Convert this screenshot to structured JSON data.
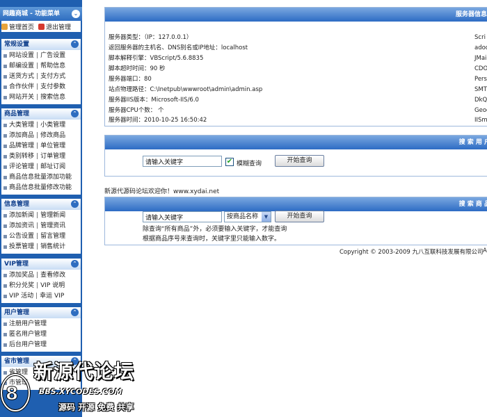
{
  "sidebar": {
    "title": "网趣商城 - 功能菜单",
    "home_link": "管理首页",
    "logout_link": "退出管理",
    "sections": [
      {
        "title": "常规设置",
        "rows": [
          [
            "网站设置",
            "广告设置"
          ],
          [
            "邮编设置",
            "帮助信息"
          ],
          [
            "送货方式",
            "支付方式"
          ],
          [
            "合作伙伴",
            "支付参数"
          ],
          [
            "网站开关",
            "搜索信息"
          ]
        ]
      },
      {
        "title": "商品管理",
        "rows": [
          [
            "大类管理",
            "小类管理"
          ],
          [
            "添加商品",
            "修改商品"
          ],
          [
            "品牌管理",
            "单位管理"
          ],
          [
            "类别转移",
            "订单管理"
          ],
          [
            "评论管理",
            "邮址订阅"
          ],
          [
            "商品信息批量添加功能"
          ],
          [
            "商品信息批量修改功能"
          ]
        ]
      },
      {
        "title": "信息管理",
        "rows": [
          [
            "添加新闻",
            "管理新闻"
          ],
          [
            "添加资讯",
            "管理资讯"
          ],
          [
            "公告设置",
            "留言管理"
          ],
          [
            "投票管理",
            "销售统计"
          ]
        ]
      },
      {
        "title": "VIP管理",
        "rows": [
          [
            "添加奖品",
            "查看修改"
          ],
          [
            "积分兑奖",
            "VIP 说明"
          ],
          [
            "VIP 活动",
            "幸运 VIP"
          ]
        ]
      },
      {
        "title": "用户管理",
        "rows": [
          [
            "注册用户管理"
          ],
          [
            "匿名用户管理"
          ],
          [
            "后台用户管理"
          ]
        ]
      },
      {
        "title": "省市管理",
        "rows": [
          [
            "省管理"
          ],
          [
            "市管理"
          ]
        ]
      }
    ]
  },
  "server_panel": {
    "title": "服务器信息统",
    "rows": [
      "服务器类型：（IP：127.0.0.1）",
      "返回服务器的主机名、DNS别名或IP地址：localhost",
      "脚本解释引擎：VBScript/5.6.8835",
      "脚本超时时间：90 秒",
      "服务器端口：80",
      "站点物理路径：C:\\Inetpub\\wwwroot\\admin\\admin.asp",
      "服务器IIS版本：Microsoft-IIS/6.0",
      "服务器CPU个数： 个",
      "服务器时间：2010-10-25 16:50:42"
    ],
    "right_col": [
      "Scri",
      "adodb",
      "JMail",
      "CDON",
      "Pers",
      "SMTP",
      "DkQm",
      "Geoc",
      "IISm"
    ]
  },
  "user_search": {
    "title": "搜 索 用 户",
    "keyword_value": "请输入关键字",
    "fuzzy_label": "模糊查询",
    "fuzzy_checked": true,
    "button": "开始查询"
  },
  "welcome_text": "新源代源码论坛欢迎你！www.xydai.net",
  "product_search": {
    "title": "搜 索 商 品",
    "keyword_value": "请输入关键字",
    "select_value": "按商品名称",
    "button": "开始查询",
    "note1": "除查询“所有商品”外，必须要输入关键字，才能查询",
    "note2": "根据商品序号来查询时，关键字里只能输入数字。"
  },
  "copyright": "Copyright © 2003-2009 九八互联科技发展有限公司 ",
  "copyright_tail": "A",
  "watermark": {
    "title": "新源代论坛",
    "url": "BBS.XYCODES.COM",
    "tagline": "源码 开源 免费 共享"
  },
  "colors": {
    "sidebar_bg": "#1f5fb0",
    "header_blue": "#2d6bc4",
    "section_title": "#0d3d8a"
  }
}
